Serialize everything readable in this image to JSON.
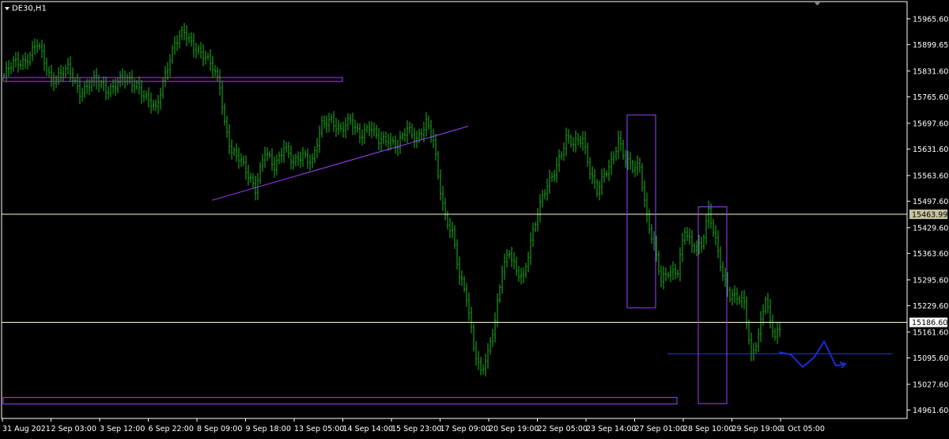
{
  "window": {
    "symbol_label": "DE30,H1"
  },
  "colors": {
    "background": "#000000",
    "frame": "#ffffff",
    "candle": "#1fb81f",
    "trendline": "#a040ff",
    "rect": "#a040ff",
    "level": "#ffffc8",
    "blueline": "#2b39d8",
    "forecast": "#1a2bd6",
    "price_tag_bg": "#c8c3a0",
    "price_tag_fg": "#000000",
    "tick_text": "#ffffff"
  },
  "chart_data": {
    "type": "bar",
    "symbol": "DE30",
    "timeframe": "H1",
    "ylim": [
      14940,
      16010
    ],
    "y_ticks": [
      "15965.60",
      "15899.65",
      "15831.60",
      "15765.60",
      "15697.60",
      "15631.60",
      "15563.60",
      "15497.60",
      "15429.60",
      "15363.60",
      "15295.60",
      "15229.60",
      "15161.60",
      "15095.60",
      "15027.60",
      "14961.60"
    ],
    "x_ticks": [
      "31 Aug 2021",
      "2 Sep 03:00",
      "3 Sep 12:00",
      "6 Sep 22:00",
      "8 Sep 09:00",
      "9 Sep 18:00",
      "13 Sep 05:00",
      "14 Sep 14:00",
      "15 Sep 23:00",
      "17 Sep 09:00",
      "20 Sep 19:00",
      "22 Sep 05:00",
      "23 Sep 14:00",
      "27 Sep 01:00",
      "28 Sep 10:00",
      "29 Sep 19:00",
      "1 Oct 05:00"
    ],
    "price_waypoints": [
      [
        0,
        15820
      ],
      [
        4,
        15850
      ],
      [
        9,
        15860
      ],
      [
        14,
        15900
      ],
      [
        20,
        15810
      ],
      [
        27,
        15835
      ],
      [
        32,
        15780
      ],
      [
        38,
        15805
      ],
      [
        44,
        15785
      ],
      [
        50,
        15810
      ],
      [
        56,
        15800
      ],
      [
        60,
        15760
      ],
      [
        64,
        15730
      ],
      [
        68,
        15830
      ],
      [
        72,
        15900
      ],
      [
        76,
        15930
      ],
      [
        80,
        15900
      ],
      [
        84,
        15870
      ],
      [
        88,
        15840
      ],
      [
        91,
        15800
      ],
      [
        93,
        15700
      ],
      [
        96,
        15620
      ],
      [
        100,
        15600
      ],
      [
        103,
        15570
      ],
      [
        106,
        15530
      ],
      [
        110,
        15620
      ],
      [
        114,
        15590
      ],
      [
        118,
        15640
      ],
      [
        122,
        15590
      ],
      [
        126,
        15620
      ],
      [
        130,
        15600
      ],
      [
        134,
        15690
      ],
      [
        138,
        15710
      ],
      [
        142,
        15680
      ],
      [
        146,
        15700
      ],
      [
        150,
        15670
      ],
      [
        154,
        15690
      ],
      [
        158,
        15650
      ],
      [
        162,
        15660
      ],
      [
        166,
        15640
      ],
      [
        170,
        15680
      ],
      [
        174,
        15660
      ],
      [
        178,
        15700
      ],
      [
        181,
        15650
      ],
      [
        183,
        15560
      ],
      [
        186,
        15460
      ],
      [
        189,
        15420
      ],
      [
        192,
        15300
      ],
      [
        195,
        15250
      ],
      [
        198,
        15130
      ],
      [
        201,
        15060
      ],
      [
        204,
        15100
      ],
      [
        207,
        15190
      ],
      [
        210,
        15330
      ],
      [
        213,
        15370
      ],
      [
        216,
        15310
      ],
      [
        219,
        15300
      ],
      [
        222,
        15400
      ],
      [
        225,
        15470
      ],
      [
        228,
        15520
      ],
      [
        231,
        15560
      ],
      [
        234,
        15610
      ],
      [
        237,
        15660
      ],
      [
        240,
        15640
      ],
      [
        244,
        15660
      ],
      [
        247,
        15580
      ],
      [
        250,
        15520
      ],
      [
        253,
        15560
      ],
      [
        256,
        15600
      ],
      [
        259,
        15660
      ],
      [
        262,
        15600
      ],
      [
        265,
        15580
      ],
      [
        268,
        15590
      ],
      [
        271,
        15460
      ],
      [
        274,
        15380
      ],
      [
        277,
        15290
      ],
      [
        280,
        15320
      ],
      [
        284,
        15320
      ],
      [
        287,
        15420
      ],
      [
        290,
        15380
      ],
      [
        294,
        15390
      ],
      [
        297,
        15470
      ],
      [
        300,
        15390
      ],
      [
        303,
        15310
      ],
      [
        306,
        15260
      ],
      [
        309,
        15250
      ],
      [
        312,
        15230
      ],
      [
        315,
        15100
      ],
      [
        318,
        15160
      ],
      [
        321,
        15250
      ],
      [
        323,
        15180
      ],
      [
        325,
        15150
      ],
      [
        327,
        15170
      ]
    ],
    "levels": [
      15463.99,
      15186.6
    ],
    "level_tags": [
      "15463.99",
      "15186.60"
    ],
    "blue_line": {
      "from_bar": 280,
      "to_bar": 375,
      "price": 15106
    },
    "trendline": {
      "from_bar": 88,
      "from_price": 15500,
      "to_bar": 196,
      "to_price": 15690
    },
    "rectangles": [
      {
        "from_bar": 0,
        "to_bar": 143,
        "top": 15815,
        "bottom": 15805
      },
      {
        "from_bar": 0,
        "to_bar": 284,
        "top": 14994,
        "bottom": 14977
      },
      {
        "from_bar": 263,
        "to_bar": 275,
        "top": 15719,
        "bottom": 15224
      },
      {
        "from_bar": 293,
        "to_bar": 305,
        "top": 15483,
        "bottom": 14978
      }
    ],
    "forecast_path": [
      [
        327,
        15110
      ],
      [
        332,
        15104
      ],
      [
        337,
        15072
      ],
      [
        342,
        15098
      ],
      [
        346,
        15138
      ],
      [
        351,
        15075
      ],
      [
        355,
        15080
      ]
    ]
  }
}
